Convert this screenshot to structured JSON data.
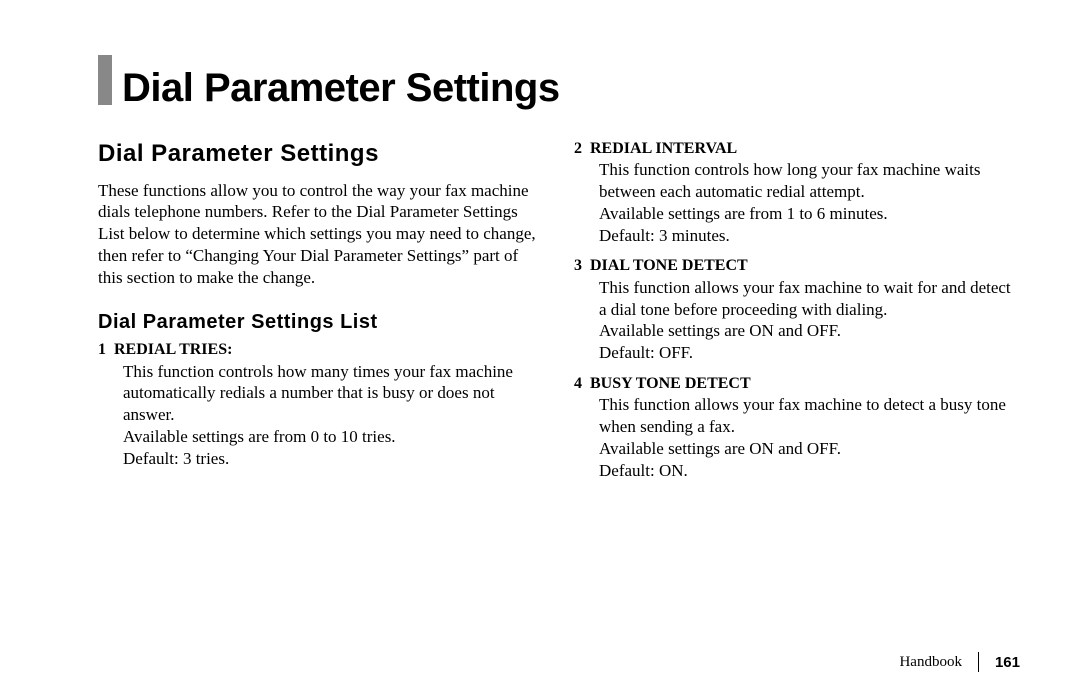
{
  "title": "Dial Parameter Settings",
  "sectionHeading": "Dial Parameter Settings",
  "intro": "These functions allow you to control the way your fax machine dials telephone numbers. Refer to the Dial Parameter Settings List below to determine which settings you may need to change, then refer to “Changing Your Dial Parameter Settings” part of this section to make the change.",
  "listHeading": "Dial Parameter Settings List",
  "items": [
    {
      "num": "1",
      "name": "REDIAL TRIES:",
      "desc": "This function controls how many times your fax machine automatically redials a number that is busy or does not answer.",
      "avail": "Available settings are from 0 to 10 tries.",
      "def": "Default: 3 tries."
    },
    {
      "num": "2",
      "name": "REDIAL INTERVAL",
      "desc": "This function controls how long your fax machine waits between each automatic redial attempt.",
      "avail": "Available settings are from 1 to 6 minutes.",
      "def": "Default: 3 minutes."
    },
    {
      "num": "3",
      "name": "DIAL TONE DETECT",
      "desc": "This function allows your fax machine to wait for and detect a dial tone before proceeding with dialing.",
      "avail": "Available settings are ON and OFF.",
      "def": "Default: OFF."
    },
    {
      "num": "4",
      "name": "BUSY TONE DETECT",
      "desc": "This function allows your fax machine to detect a busy tone when sending a fax.",
      "avail": "Available settings are ON and OFF.",
      "def": "Default: ON."
    }
  ],
  "footer": {
    "label": "Handbook",
    "page": "161"
  }
}
